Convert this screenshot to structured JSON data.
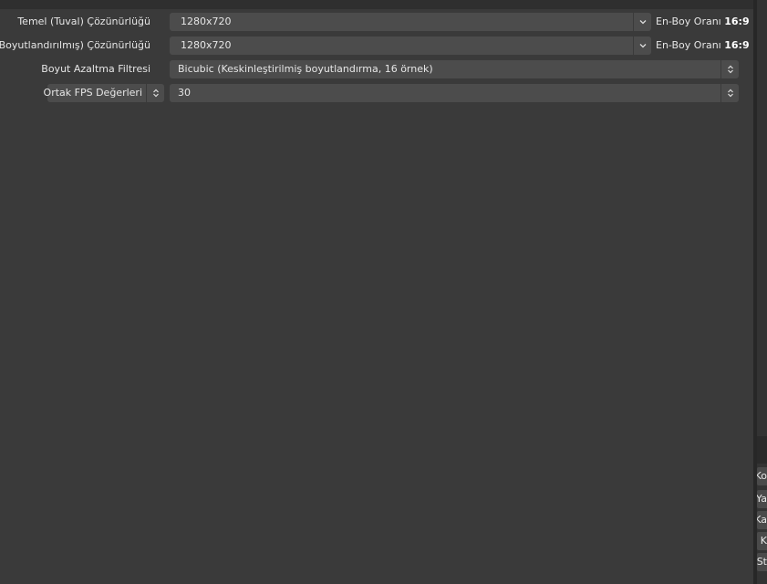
{
  "video_settings": {
    "base_resolution": {
      "label": "Temel (Tuval) Çözünürlüğü",
      "value": "1280x720",
      "aspect_label": "En-Boy Oranı",
      "aspect_value": "16:9"
    },
    "output_resolution": {
      "label": "Çıkış (Boyutlandırılmış) Çözünürlüğü",
      "value": "1280x720",
      "aspect_label": "En-Boy Oranı",
      "aspect_value": "16:9"
    },
    "downscale_filter": {
      "label": "Boyut Azaltma Filtresi",
      "value": "Bicubic (Keskinleştirilmiş boyutlandırma, 16 örnek)"
    },
    "fps": {
      "type_label": "Ortak FPS Değerleri",
      "value": "30"
    }
  },
  "side_buttons": [
    {
      "label": "Ko"
    },
    {
      "label": "Ya"
    },
    {
      "label": "Ka"
    },
    {
      "label": "al K"
    },
    {
      "label": "St"
    }
  ],
  "colors": {
    "background": "#3a3a3a",
    "field": "#4c4c4c",
    "text": "#e6e6e6"
  }
}
